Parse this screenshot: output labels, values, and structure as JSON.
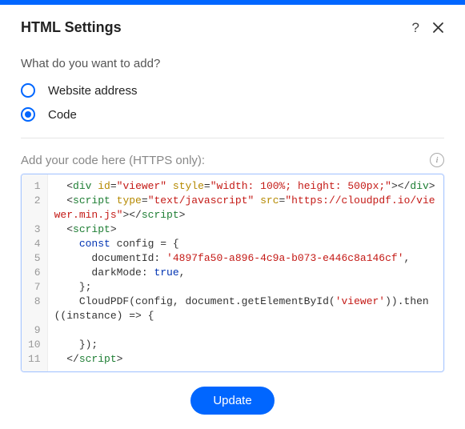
{
  "header": {
    "title": "HTML Settings"
  },
  "prompt": "What do you want to add?",
  "options": {
    "website": "Website address",
    "code": "Code",
    "selected": "code"
  },
  "code_section": {
    "label": "Add your code here (HTTPS only):"
  },
  "code_lines": {
    "ln1": "1",
    "ln2": "2",
    "ln3": "3",
    "ln4": "4",
    "ln5": "5",
    "ln6": "6",
    "ln7": "7",
    "ln8": "8",
    "ln9": "9",
    "ln10": "10",
    "ln11": "11"
  },
  "code": {
    "l1": {
      "indent": "  <",
      "tag1": "div",
      "sp": " ",
      "attr1": "id",
      "eq": "=",
      "val1": "\"viewer\"",
      "sp2": " ",
      "attr2": "style",
      "eq2": "=",
      "val2": "\"width: 100%; height: 500px;\"",
      "close": "></",
      "tag2": "div",
      "end": ">"
    },
    "l2": {
      "indent": "  <",
      "tag1": "script",
      "sp": " ",
      "attr1": "type",
      "eq": "=",
      "val1": "\"text/javascript\"",
      "sp2": " ",
      "attr2": "src",
      "eq2": "=",
      "val2_a": "\"https://cloudpdf.io",
      "val2_b": "/viewer.min.js\"",
      "close": "></",
      "tag2": "script",
      "end": ">"
    },
    "l3": {
      "indent": "  <",
      "tag": "script",
      "end": ">"
    },
    "l4": {
      "text": "    const config = {"
    },
    "l5": {
      "pre": "      documentId: ",
      "str": "'4897fa50-a896-4c9a-b073-e446c8a146cf'",
      "post": ","
    },
    "l6": {
      "pre": "      darkMode: ",
      "bool": "true",
      "post": ","
    },
    "l7": {
      "text": "    };"
    },
    "l8": {
      "pre": "    CloudPDF(config, ",
      "mid_a": "document.getElementById(",
      "str": "'viewer'",
      "mid_b": ")).then((instance) => {"
    },
    "l9": {
      "text": ""
    },
    "l10": {
      "text": "    });"
    },
    "l11": {
      "indent": "  </",
      "tag": "script",
      "end": ">"
    }
  },
  "footer": {
    "update": "Update"
  }
}
